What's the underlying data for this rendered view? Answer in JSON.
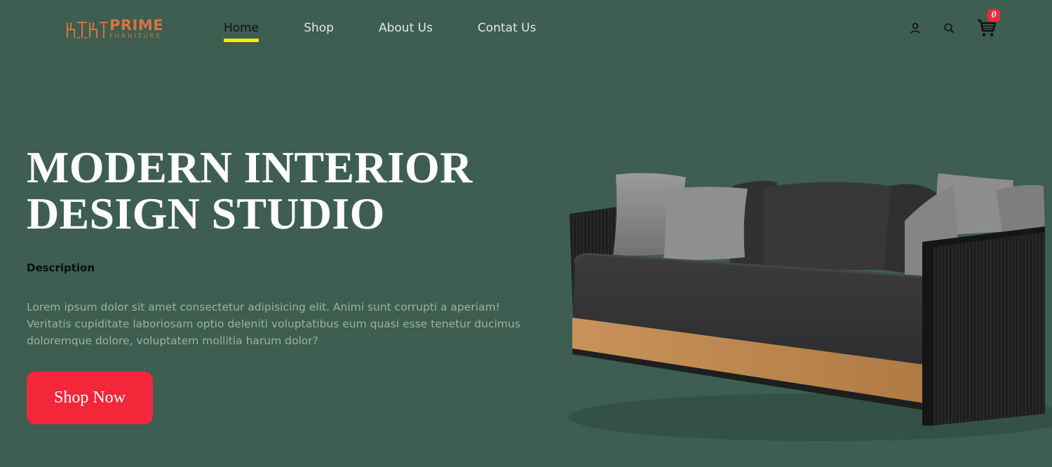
{
  "brand": {
    "name": "PRIME",
    "tagline": "FURNITURE",
    "color": "#d9733f"
  },
  "nav": {
    "items": [
      {
        "label": "Home",
        "active": true
      },
      {
        "label": "Shop",
        "active": false
      },
      {
        "label": "About Us",
        "active": false
      },
      {
        "label": "Contat Us",
        "active": false
      }
    ],
    "active_underline_color": "#ffea00"
  },
  "header_icons": {
    "user": "user-icon",
    "search": "search-icon",
    "cart": "cart-icon",
    "cart_count": "0",
    "badge_color": "#f02a3a"
  },
  "hero": {
    "title_line1": "MODERN INTERIOR",
    "title_line2": "DESIGN STUDIO",
    "description_label": "Description",
    "description": "Lorem ipsum dolor sit amet consectetur adipisicing elit. Animi sunt corrupti a aperiam! Veritatis cupiditate laboriosam optio deleniti voluptatibus eum quasi esse tenetur ducimus doloremque dolore, voluptatem mollitia harum dolor?",
    "cta_label": "Shop Now",
    "cta_color": "#f4263a"
  },
  "colors": {
    "background": "#3d5e50"
  }
}
